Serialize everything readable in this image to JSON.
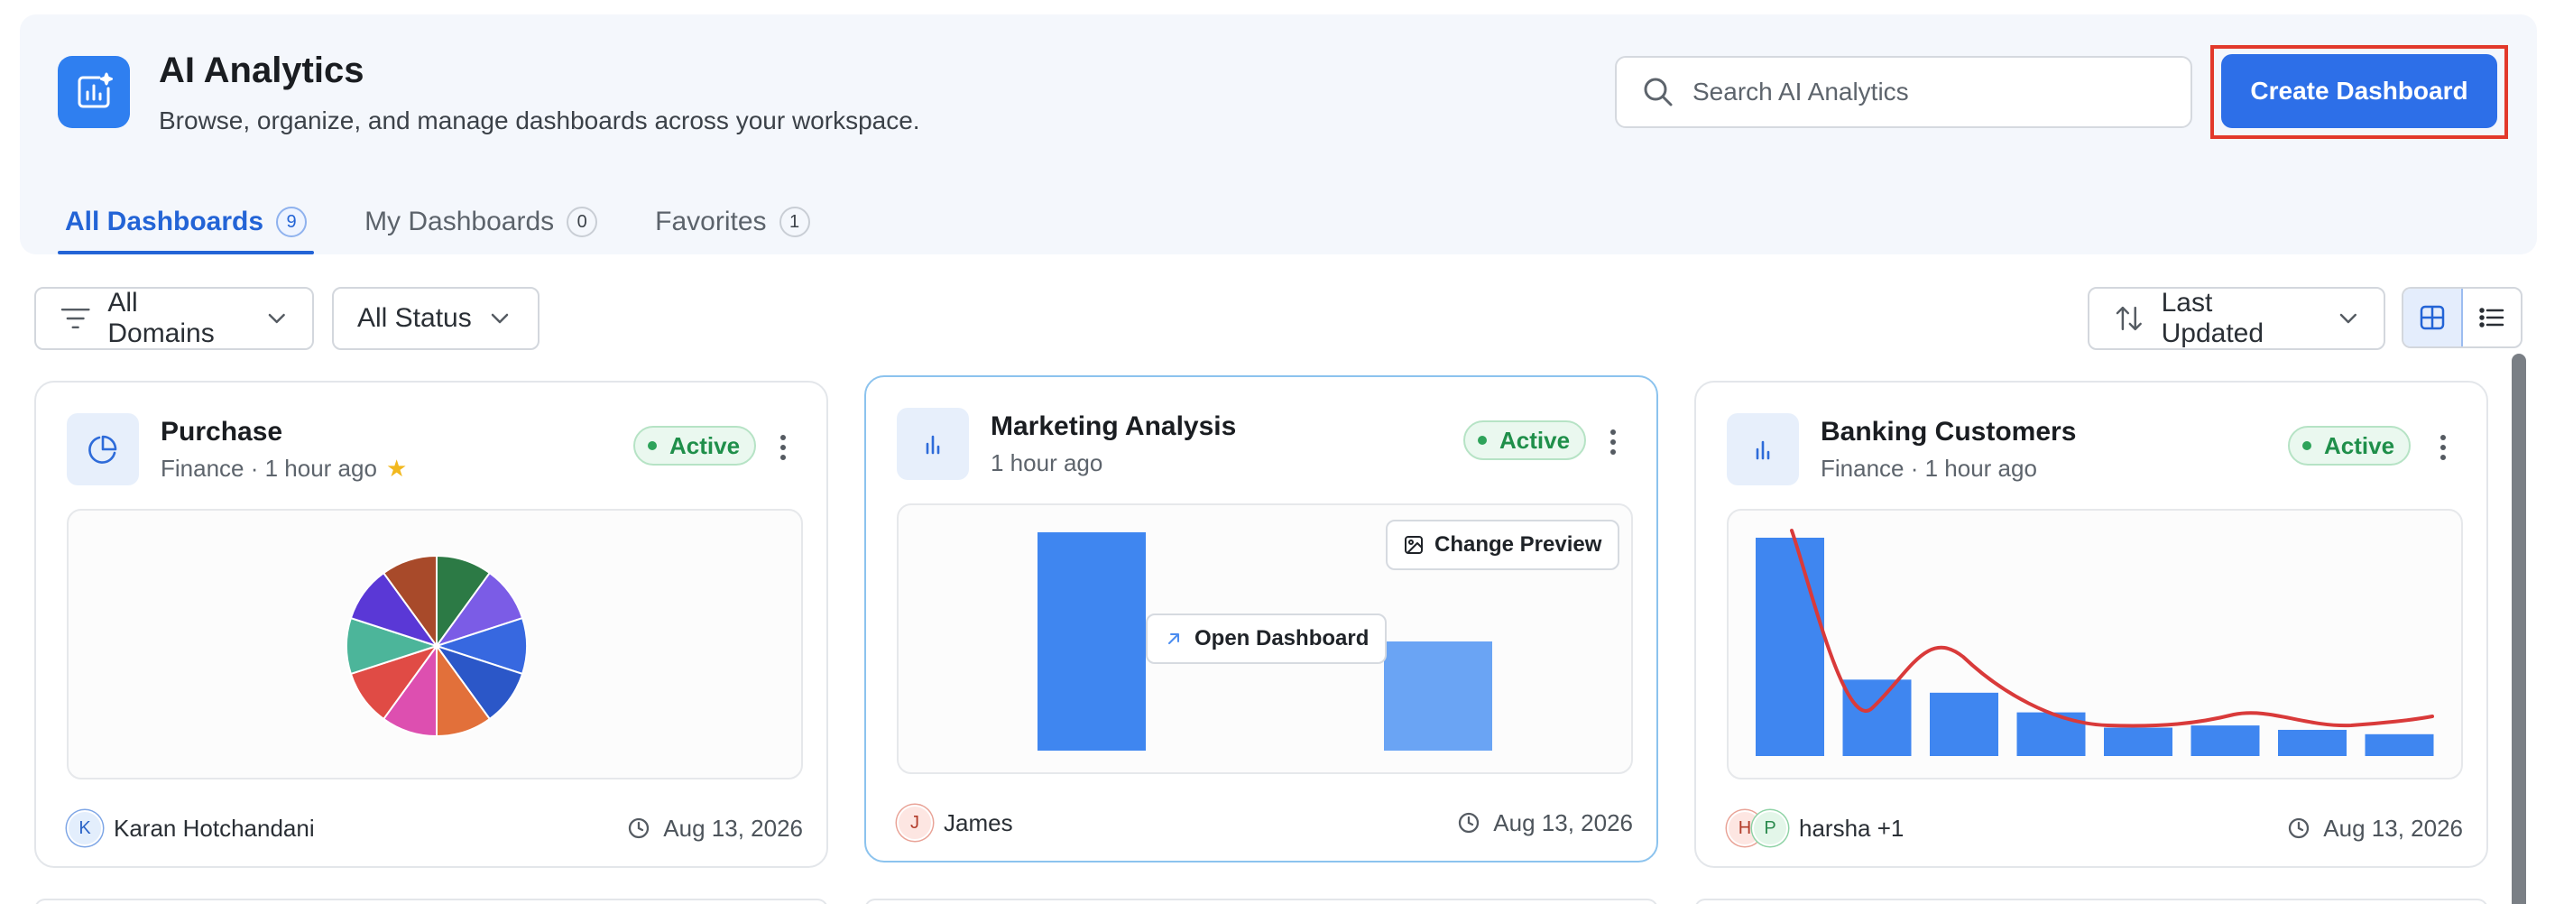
{
  "header": {
    "title": "AI Analytics",
    "subtitle": "Browse, organize, and manage dashboards across your workspace.",
    "search_placeholder": "Search AI Analytics",
    "create_label": "Create Dashboard"
  },
  "tabs": [
    {
      "label": "All Dashboards",
      "count": "9",
      "active": true
    },
    {
      "label": "My Dashboards",
      "count": "0",
      "active": false
    },
    {
      "label": "Favorites",
      "count": "1",
      "active": false
    }
  ],
  "filters": {
    "domain": "All Domains",
    "status": "All Status",
    "sort": "Last Updated",
    "view": "grid"
  },
  "cards": [
    {
      "title": "Purchase",
      "domain": "Finance",
      "updated": "1 hour ago",
      "favorite": true,
      "status": "Active",
      "preview_type": "pie",
      "owner_initials": [
        "K"
      ],
      "owner": "Karan Hotchandani",
      "date": "Aug 13, 2026",
      "pie_colors": [
        "#2c7a45",
        "#7b5ce6",
        "#3768e0",
        "#2b57c8",
        "#e2703a",
        "#dd4fb0",
        "#e04b45",
        "#4cb59a",
        "#5a38d6",
        "#a84a2a"
      ]
    },
    {
      "title": "Marketing Analysis",
      "domain": "",
      "updated": "1 hour ago",
      "favorite": false,
      "status": "Active",
      "preview_type": "bar",
      "owner_initials": [
        "J"
      ],
      "owner": "James",
      "date": "Aug 13, 2026",
      "change_preview": "Change Preview",
      "open_dashboard": "Open Dashboard",
      "bar_values": [
        100,
        50
      ]
    },
    {
      "title": "Banking Customers",
      "domain": "Finance",
      "updated": "1 hour ago",
      "favorite": false,
      "status": "Active",
      "preview_type": "bar-line",
      "owner_initials": [
        "H",
        "P"
      ],
      "owner": "harsha +1",
      "date": "Aug 13, 2026",
      "bar_values": [
        100,
        35,
        29,
        20,
        13,
        14,
        12,
        10
      ]
    }
  ],
  "colors": {
    "accent": "#2d6fe8",
    "active_status": "#1f8f4a",
    "bar_primary": "#3f86f0",
    "bar_secondary": "#6aa4f4",
    "trend_line": "#d93a3a"
  }
}
